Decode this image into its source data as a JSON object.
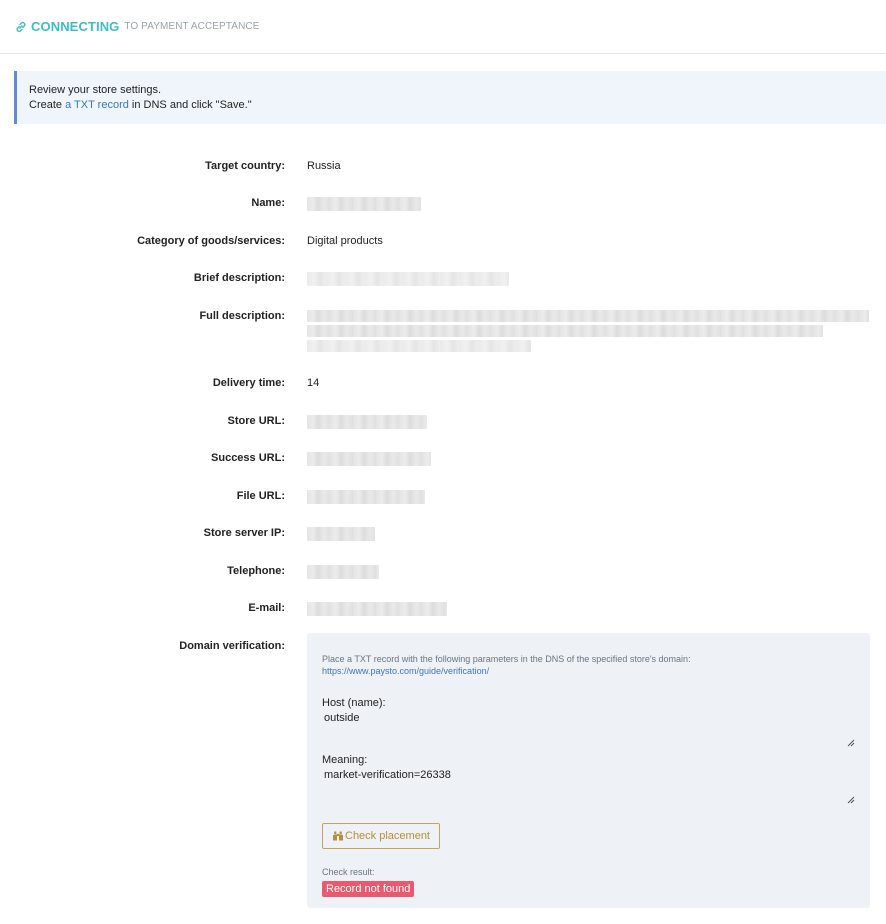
{
  "header": {
    "title": "CONNECTING",
    "subtitle": "TO PAYMENT ACCEPTANCE"
  },
  "notice": {
    "line1": "Review your store settings.",
    "line2_prefix": "Create ",
    "line2_link": "a TXT record",
    "line2_suffix": " in DNS and click \"Save.\""
  },
  "fields": {
    "target_country": {
      "label": "Target country:",
      "value": "Russia"
    },
    "name": {
      "label": "Name:"
    },
    "category": {
      "label": "Category of goods/services:",
      "value": "Digital products"
    },
    "brief_description": {
      "label": "Brief description:"
    },
    "full_description": {
      "label": "Full description:"
    },
    "delivery_time": {
      "label": "Delivery time:",
      "value": "14"
    },
    "store_url": {
      "label": "Store URL:"
    },
    "success_url": {
      "label": "Success URL:"
    },
    "file_url": {
      "label": "File URL:"
    },
    "store_server_ip": {
      "label": "Store server IP:"
    },
    "telephone": {
      "label": "Telephone:"
    },
    "email": {
      "label": "E-mail:"
    },
    "domain_verification": {
      "label": "Domain verification:"
    }
  },
  "verification": {
    "hint": "Place a TXT record with the following parameters in the DNS of the specified store's domain:",
    "guide_link": "https://www.paysto.com/guide/verification/",
    "host_label": "Host (name):",
    "host_value": "outside",
    "meaning_label": "Meaning:",
    "meaning_value": "market-verification=26338",
    "check_button": "Check placement",
    "check_result_label": "Check result:",
    "check_result_badge": "Record not found"
  },
  "colors": {
    "accent_teal": "#3cbec4",
    "link_blue": "#3a76c4",
    "button_gold": "#b48f39",
    "error_badge": "#ea5a6e",
    "notice_bg": "#f0f5fb"
  },
  "icons": {
    "header": "link-icon",
    "check_button": "binoculars-icon"
  }
}
